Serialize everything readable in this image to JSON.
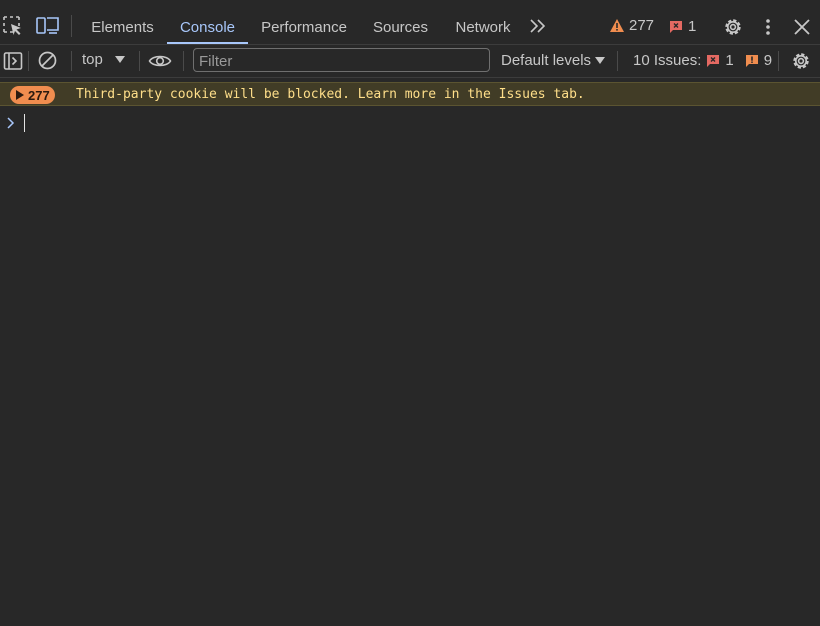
{
  "tabs": [
    {
      "label": "Elements"
    },
    {
      "label": "Console"
    },
    {
      "label": "Performance"
    },
    {
      "label": "Sources"
    },
    {
      "label": "Network"
    }
  ],
  "active_tab": "Console",
  "status": {
    "warnings": "277",
    "errors": "1"
  },
  "toolbar": {
    "context": "top",
    "filter_placeholder": "Filter",
    "filter_value": "",
    "levels": "Default levels",
    "issues_label": "10 Issues:",
    "issues_errors": "1",
    "issues_warnings": "9"
  },
  "console": {
    "messages": [
      {
        "count": "277",
        "text": "Third-party cookie will be blocked. Learn more in the Issues tab."
      }
    ]
  },
  "icons": {
    "inspect": "inspect-element-icon",
    "device": "device-toolbar-icon",
    "more": "chevron-double-right-icon",
    "warning": "warning-triangle-icon",
    "error": "error-flag-icon",
    "settings": "gear-icon",
    "kebab": "more-vertical-icon",
    "close": "close-icon",
    "sidebar": "sidebar-toggle-icon",
    "clear": "clear-console-icon",
    "eye": "live-expression-eye-icon",
    "prompt": "prompt-chevron-icon"
  },
  "colors": {
    "background": "#282828",
    "accent": "#a8c7fa",
    "warning": "#f08d4f",
    "error": "#e46962",
    "warning_row_bg": "#413c26",
    "warning_text": "#ffdf8a"
  }
}
